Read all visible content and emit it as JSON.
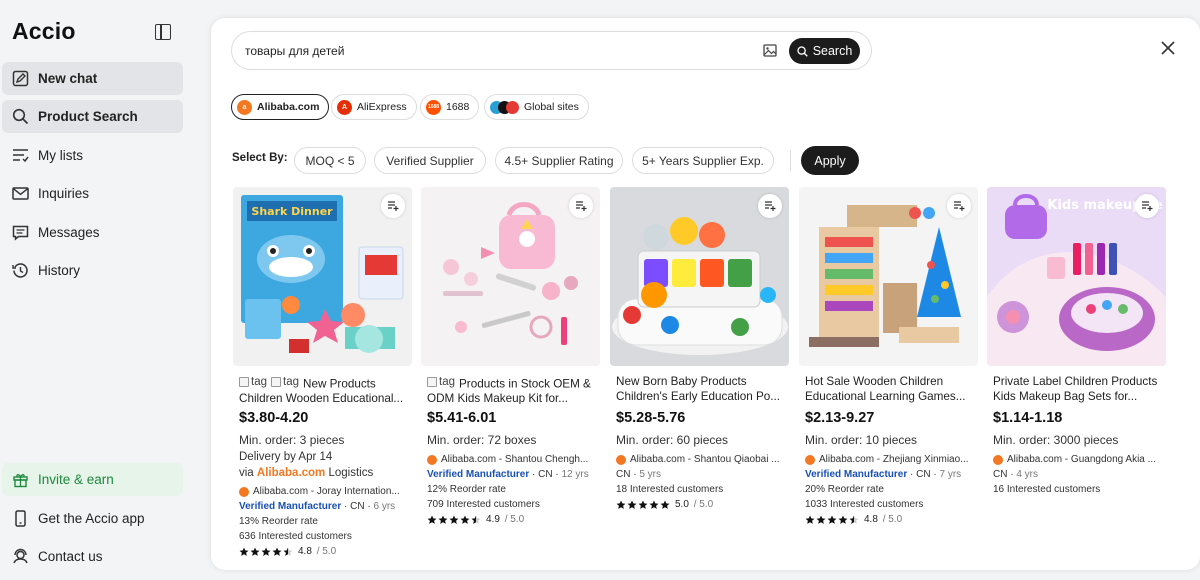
{
  "app": {
    "name": "Accio"
  },
  "sidebar": {
    "items": [
      {
        "label": "New chat",
        "icon": "new-chat-icon"
      },
      {
        "label": "Product Search",
        "icon": "search-icon"
      },
      {
        "label": "My lists",
        "icon": "list-icon"
      },
      {
        "label": "Inquiries",
        "icon": "mail-icon"
      },
      {
        "label": "Messages",
        "icon": "message-icon"
      },
      {
        "label": "History",
        "icon": "history-icon"
      }
    ],
    "bottom": [
      {
        "label": "Invite & earn",
        "icon": "gift-icon"
      },
      {
        "label": "Get the Accio app",
        "icon": "phone-icon"
      },
      {
        "label": "Contact us",
        "icon": "headset-icon"
      }
    ]
  },
  "search": {
    "query": "товары для детей",
    "button_label": "Search"
  },
  "sites": [
    {
      "label": "Alibaba.com",
      "active": true,
      "color": "#f37821"
    },
    {
      "label": "AliExpress",
      "active": false,
      "color": "#e62e04"
    },
    {
      "label": "1688",
      "active": false,
      "color": "#ff5000",
      "logo_text": "1688"
    },
    {
      "label": "Global sites",
      "active": false,
      "color": "#3a7bd5"
    }
  ],
  "filters": {
    "label": "Select By:",
    "options": [
      "MOQ < 5",
      "Verified Supplier",
      "4.5+ Supplier Rating",
      "5+ Years Supplier Exp."
    ],
    "apply_label": "Apply"
  },
  "products": [
    {
      "title_prefix": "tag",
      "title_prefix2": "tag",
      "title": "New Products Children Wooden Educational...",
      "price": "$3.80-4.20",
      "moq": "Min. order: 3 pieces",
      "delivery": "Delivery by Apr 14",
      "logistics_via": "via",
      "logistics_brand": "Alibaba.com",
      "logistics_label": "Logistics",
      "supplier": "Alibaba.com - Joray Internation...",
      "verified": "Verified Manufacturer",
      "country": "CN",
      "years": "6 yrs",
      "reorder": "13% Reorder rate",
      "interested": "636 Interested customers",
      "rating": "4.8",
      "rating_max": "/ 5.0"
    },
    {
      "title_prefix": "tag",
      "title": "Products in Stock OEM & ODM Kids Makeup Kit for...",
      "price": "$5.41-6.01",
      "moq": "Min. order: 72 boxes",
      "supplier": "Alibaba.com - Shantou Chengh...",
      "verified": "Verified Manufacturer",
      "country": "CN",
      "years": "12 yrs",
      "reorder": "12% Reorder rate",
      "interested": "709 Interested customers",
      "rating": "4.9",
      "rating_max": "/ 5.0"
    },
    {
      "title": "New Born Baby Products Children's Early Education Po...",
      "price": "$5.28-5.76",
      "moq": "Min. order: 60 pieces",
      "supplier": "Alibaba.com - Shantou Qiaobai ...",
      "country": "CN",
      "years": "5 yrs",
      "interested": "18 Interested customers",
      "rating": "5.0",
      "rating_max": "/ 5.0"
    },
    {
      "title": "Hot Sale Wooden Children Educational Learning Games...",
      "price": "$2.13-9.27",
      "moq": "Min. order: 10 pieces",
      "supplier": "Alibaba.com - Zhejiang Xinmiao...",
      "verified": "Verified Manufacturer",
      "country": "CN",
      "years": "7 yrs",
      "reorder": "20% Reorder rate",
      "interested": "1033 Interested customers",
      "rating": "4.8",
      "rating_max": "/ 5.0"
    },
    {
      "title": "Private Label Children Products Kids Makeup Bag Sets for...",
      "price": "$1.14-1.18",
      "moq": "Min. order: 3000 pieces",
      "supplier": "Alibaba.com - Guangdong Akia ...",
      "country": "CN",
      "years": "4 yrs",
      "interested": "16 Interested customers",
      "image_text": "Kids makeup se"
    }
  ],
  "image_labels": {
    "shark": "Shark Dinner"
  }
}
